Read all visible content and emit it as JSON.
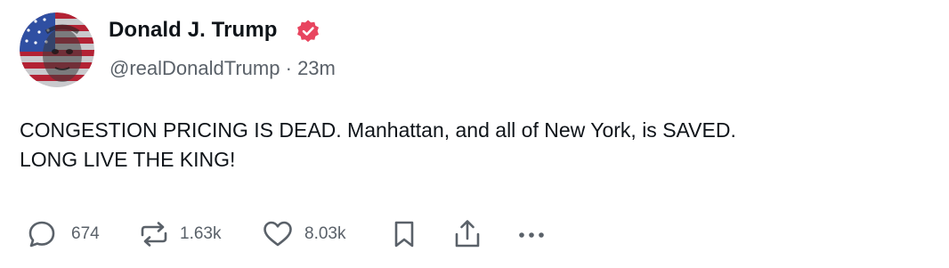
{
  "author": {
    "display_name": "Donald J. Trump",
    "handle": "@realDonaldTrump",
    "separator": "·",
    "time_ago": "23m",
    "avatar_icon": "avatar-flag-portrait",
    "verified_icon": "verified-badge-icon"
  },
  "post": {
    "text_line_1": "CONGESTION PRICING IS DEAD. Manhattan, and all of New York, is SAVED.",
    "text_line_2": "LONG LIVE THE KING!"
  },
  "actions": {
    "reply": {
      "icon": "reply-icon",
      "count": "674"
    },
    "repost": {
      "icon": "repost-icon",
      "count": "1.63k"
    },
    "like": {
      "icon": "heart-icon",
      "count": "8.03k"
    },
    "bookmark": {
      "icon": "bookmark-icon"
    },
    "share": {
      "icon": "share-icon"
    },
    "more": {
      "icon": "more-icon"
    }
  },
  "colors": {
    "verified_badge": "#e8455f",
    "text_primary": "#0f1419",
    "text_secondary": "#5a6169"
  }
}
